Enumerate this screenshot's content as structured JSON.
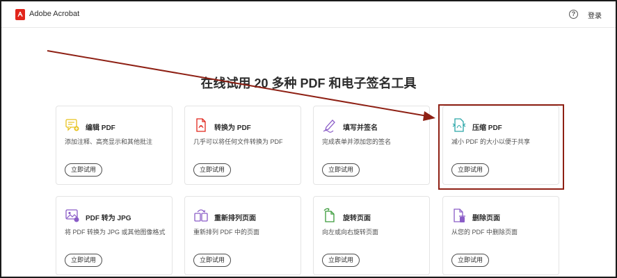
{
  "header": {
    "brand": "Adobe Acrobat",
    "help_glyph": "?",
    "signin_label": "登录"
  },
  "main": {
    "headline": "在线试用 20 多种 PDF 和电子签名工具",
    "cards": [
      {
        "title": "编辑 PDF",
        "desc": "添加注释、高亮显示和其他批注",
        "button": "立即试用",
        "icon": "edit-pdf-icon"
      },
      {
        "title": "转换为 PDF",
        "desc": "几乎可以将任何文件转换为 PDF",
        "button": "立即试用",
        "icon": "convert-pdf-icon"
      },
      {
        "title": "填写并签名",
        "desc": "完成表单并添加您的签名",
        "button": "立即试用",
        "icon": "fill-sign-icon"
      },
      {
        "title": "压缩 PDF",
        "desc": "减小 PDF 的大小以便于共享",
        "button": "立即试用",
        "icon": "compress-pdf-icon"
      },
      {
        "title": "PDF 转为 JPG",
        "desc": "将 PDF 转换为 JPG 或其他图像格式",
        "button": "立即试用",
        "icon": "pdf-to-jpg-icon"
      },
      {
        "title": "重新排列页面",
        "desc": "重新排列 PDF 中的页面",
        "button": "立即试用",
        "icon": "reorder-pages-icon"
      },
      {
        "title": "旋转页面",
        "desc": "向左或向右旋转页面",
        "button": "立即试用",
        "icon": "rotate-pages-icon"
      },
      {
        "title": "删除页面",
        "desc": "从您的 PDF 中删除页面",
        "button": "立即试用",
        "icon": "delete-pages-icon"
      }
    ]
  },
  "colors": {
    "brand_red": "#e1251b",
    "annotation_red": "#8e2014",
    "icon_purple": "#8a5cc7",
    "icon_teal": "#2aa6a8",
    "icon_yellow": "#e8c21e"
  }
}
